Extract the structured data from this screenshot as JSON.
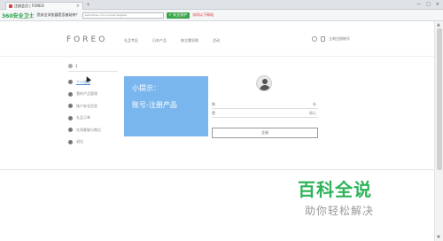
{
  "browser": {
    "tab_title": "注册会员 | FOREO",
    "tab_close": "×",
    "new_tab": "+",
    "window_controls": [
      "—",
      "□",
      "×"
    ]
  },
  "toolbar": {
    "logo": "360",
    "logo_suffix": "安全卫士",
    "notice": "您安全浏览器是否被劫持？",
    "search_text": "www.foreo.com.cn/user/register",
    "protect_button": "✔ 安全保护",
    "red_link": "访问以下网站"
  },
  "header": {
    "brand": "FOREO",
    "nav": [
      "礼品专区",
      "日本产品",
      "按主题导购",
      "活动"
    ],
    "account_label": "立刻注册账号"
  },
  "sidebar": {
    "username": "1",
    "items": [
      {
        "label": "个人信息",
        "icon": "home-icon",
        "active": true
      },
      {
        "label": "我的产品管理",
        "icon": "lock-icon",
        "active": false
      },
      {
        "label": "账户安全信息",
        "icon": "shield-icon",
        "active": false
      },
      {
        "label": "礼品订单",
        "icon": "gift-icon",
        "active": false
      },
      {
        "label": "在线客服与售后",
        "icon": "support-icon",
        "active": false
      },
      {
        "label": "退出",
        "icon": "logout-icon",
        "active": false
      }
    ]
  },
  "tooltip": {
    "title": "小提示：",
    "body": "账号-注册产品"
  },
  "register_form": {
    "field1_label": "账",
    "field1_right": "新",
    "field2_label": "密",
    "field2_right": "确认",
    "submit": "注册"
  },
  "watermark": {
    "line1": "百科全说",
    "line2": "助你轻松解决"
  },
  "colors": {
    "tooltip_bg": "#7ab6ee",
    "watermark_green": "#2fb35a",
    "active_link": "#4a8bd6"
  }
}
